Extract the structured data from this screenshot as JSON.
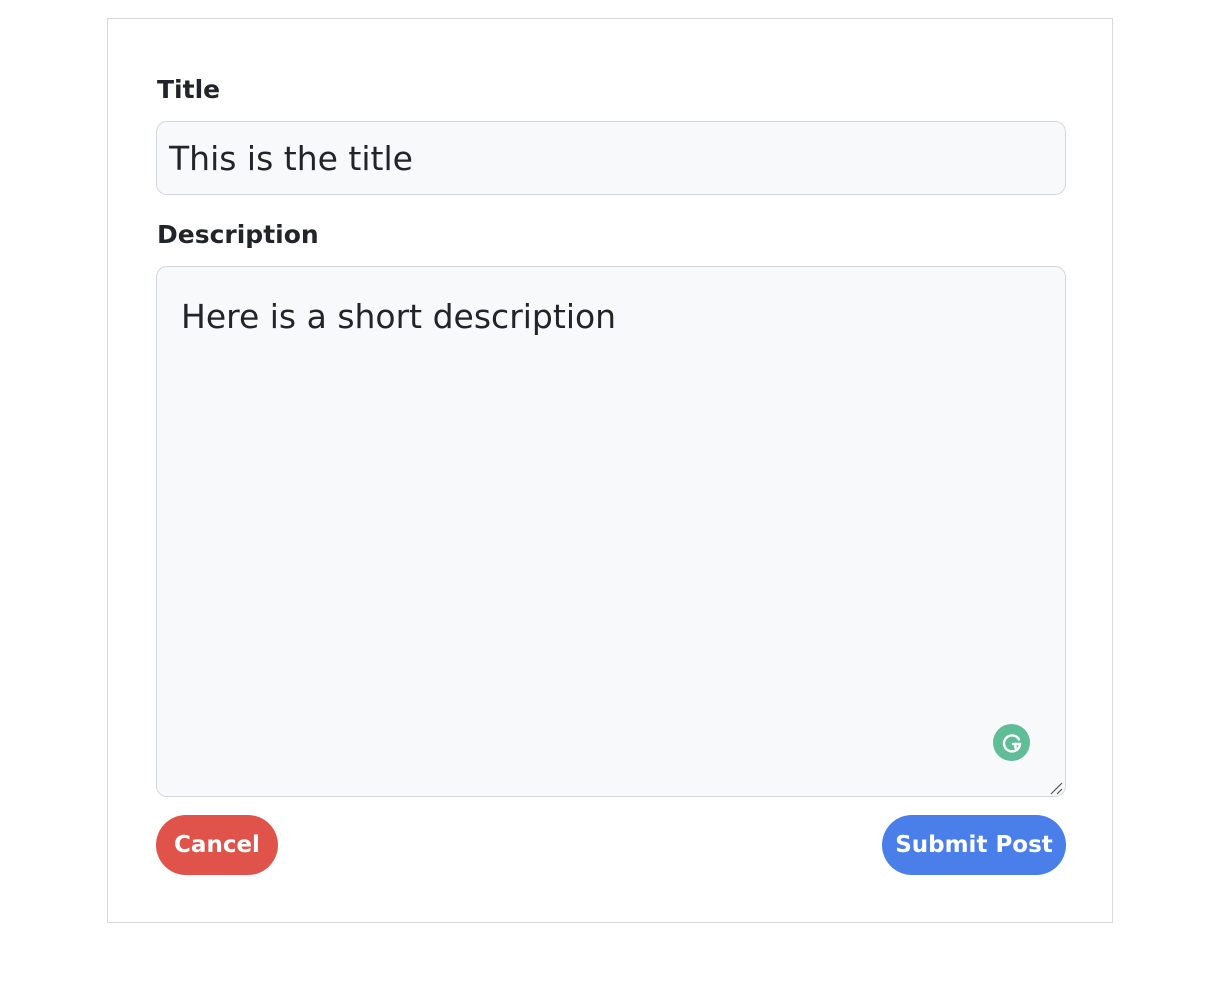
{
  "form": {
    "title_label": "Title",
    "title_value": "This is the title",
    "description_label": "Description",
    "description_value": "Here is a short description"
  },
  "actions": {
    "cancel_label": "Cancel",
    "submit_label": "Submit Post"
  },
  "icons": {
    "assistant": "grammarly-icon",
    "resize": "resize-handle-icon"
  },
  "colors": {
    "cancel": "#e0534b",
    "submit": "#4a7fe9",
    "grammarly": "#5fbd97",
    "field_background": "#f8f9fa"
  }
}
